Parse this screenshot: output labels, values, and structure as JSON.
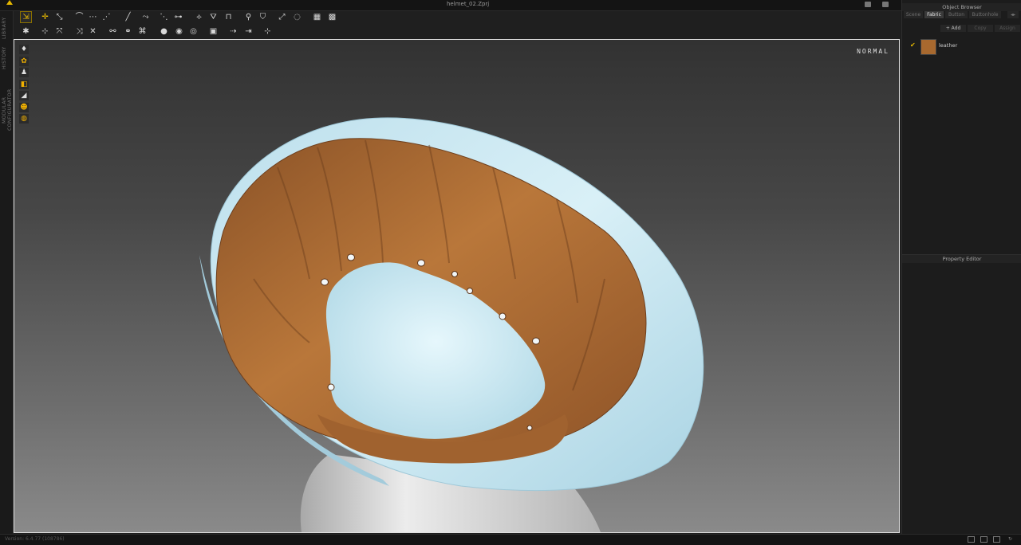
{
  "app": {
    "file_title": "helmet_02.Zprj"
  },
  "left_tabs": [
    "LIBRARY",
    "HISTORY",
    "MODULAR CONFIGURATOR"
  ],
  "viewport": {
    "mode_label": "NORMAL"
  },
  "object_browser": {
    "title": "Object Browser",
    "tabs": [
      "Scene",
      "Fabric",
      "Button",
      "Buttonhole"
    ],
    "active_tab": "Fabric",
    "actions": [
      "+ Add",
      "Copy",
      "Assign"
    ],
    "fabrics": [
      {
        "name": "leather",
        "color": "#a8692f",
        "checked": true
      }
    ]
  },
  "property_editor": {
    "title": "Property Editor"
  },
  "status": {
    "version": "Version: 6.4.77 (108786)"
  },
  "colors": {
    "accent": "#f0c000",
    "leather": "#a8692f",
    "shell": "#cfeaf3",
    "avatar": "#e6e6e6"
  }
}
